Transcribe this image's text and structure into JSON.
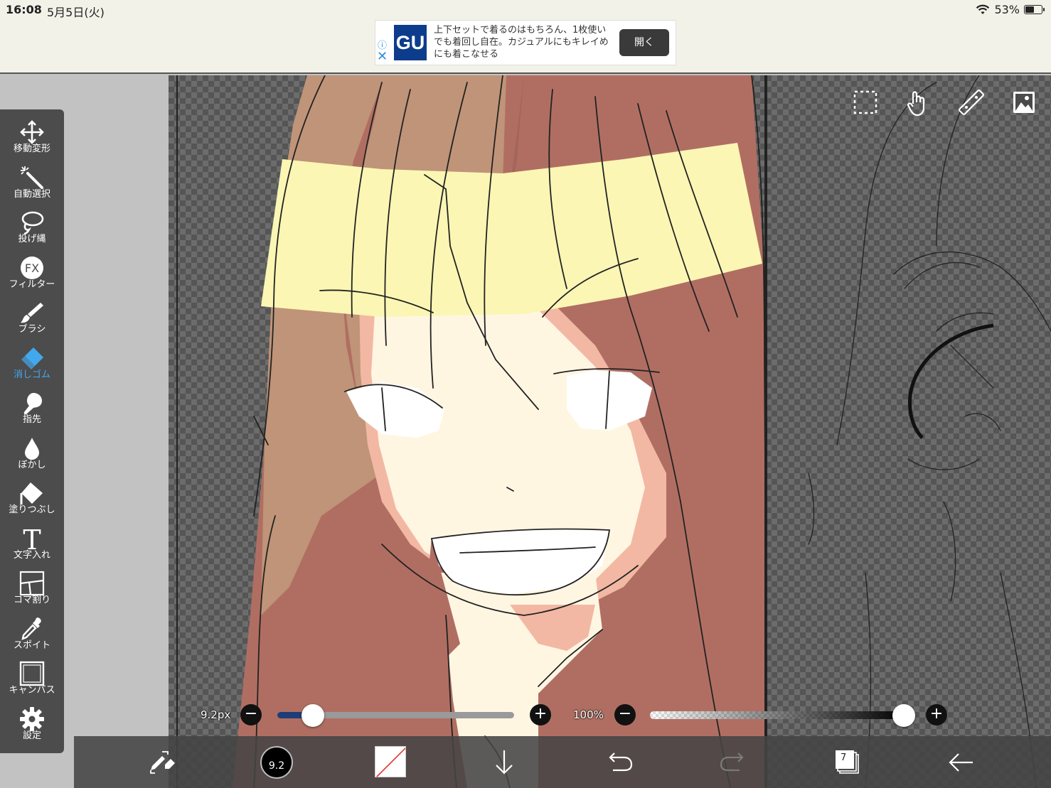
{
  "status_bar": {
    "time": "16:08",
    "date": "5月5日(火)",
    "battery": "53%"
  },
  "ad": {
    "logo": "GU",
    "text": "上下セットで着るのはもちろん、1枚使いでも着回し自在。カジュアルにもキレイめにも着こなせる",
    "open_label": "開く",
    "info_glyph": "ⓘ",
    "close_glyph": "✕"
  },
  "tools": [
    {
      "label": "移動変形",
      "icon": "move-arrows-icon"
    },
    {
      "label": "自動選択",
      "icon": "magic-wand-icon"
    },
    {
      "label": "投げ縄",
      "icon": "lasso-icon"
    },
    {
      "label": "フィルター",
      "icon": "fx-icon"
    },
    {
      "label": "ブラシ",
      "icon": "brush-icon"
    },
    {
      "label": "消しゴム",
      "icon": "eraser-icon"
    },
    {
      "label": "指先",
      "icon": "finger-icon"
    },
    {
      "label": "ぼかし",
      "icon": "drop-icon"
    },
    {
      "label": "塗りつぶし",
      "icon": "fill-bucket-icon"
    },
    {
      "label": "文字入れ",
      "icon": "text-icon"
    },
    {
      "label": "コマ割り",
      "icon": "panel-icon"
    },
    {
      "label": "スポイト",
      "icon": "eyedropper-icon"
    },
    {
      "label": "キャンバス",
      "icon": "canvas-icon"
    },
    {
      "label": "設定",
      "icon": "gear-icon"
    }
  ],
  "active_tool": "消しゴム",
  "brush": {
    "size_label": "9.2px",
    "size_value": 9.2,
    "size_short": "9.2",
    "size_fraction": 0.15
  },
  "opacity": {
    "label": "100%",
    "value": 100
  },
  "layers": {
    "count": "7"
  },
  "colors": {
    "accent": "#42a8ee",
    "toolbar_bg": "#4c4c4c",
    "hair": "#b06e62",
    "hair_light": "#bf9478",
    "highlight": "#fbf6b4",
    "skin": "#fff6e2",
    "skin_shadow": "#f2b8a4"
  }
}
